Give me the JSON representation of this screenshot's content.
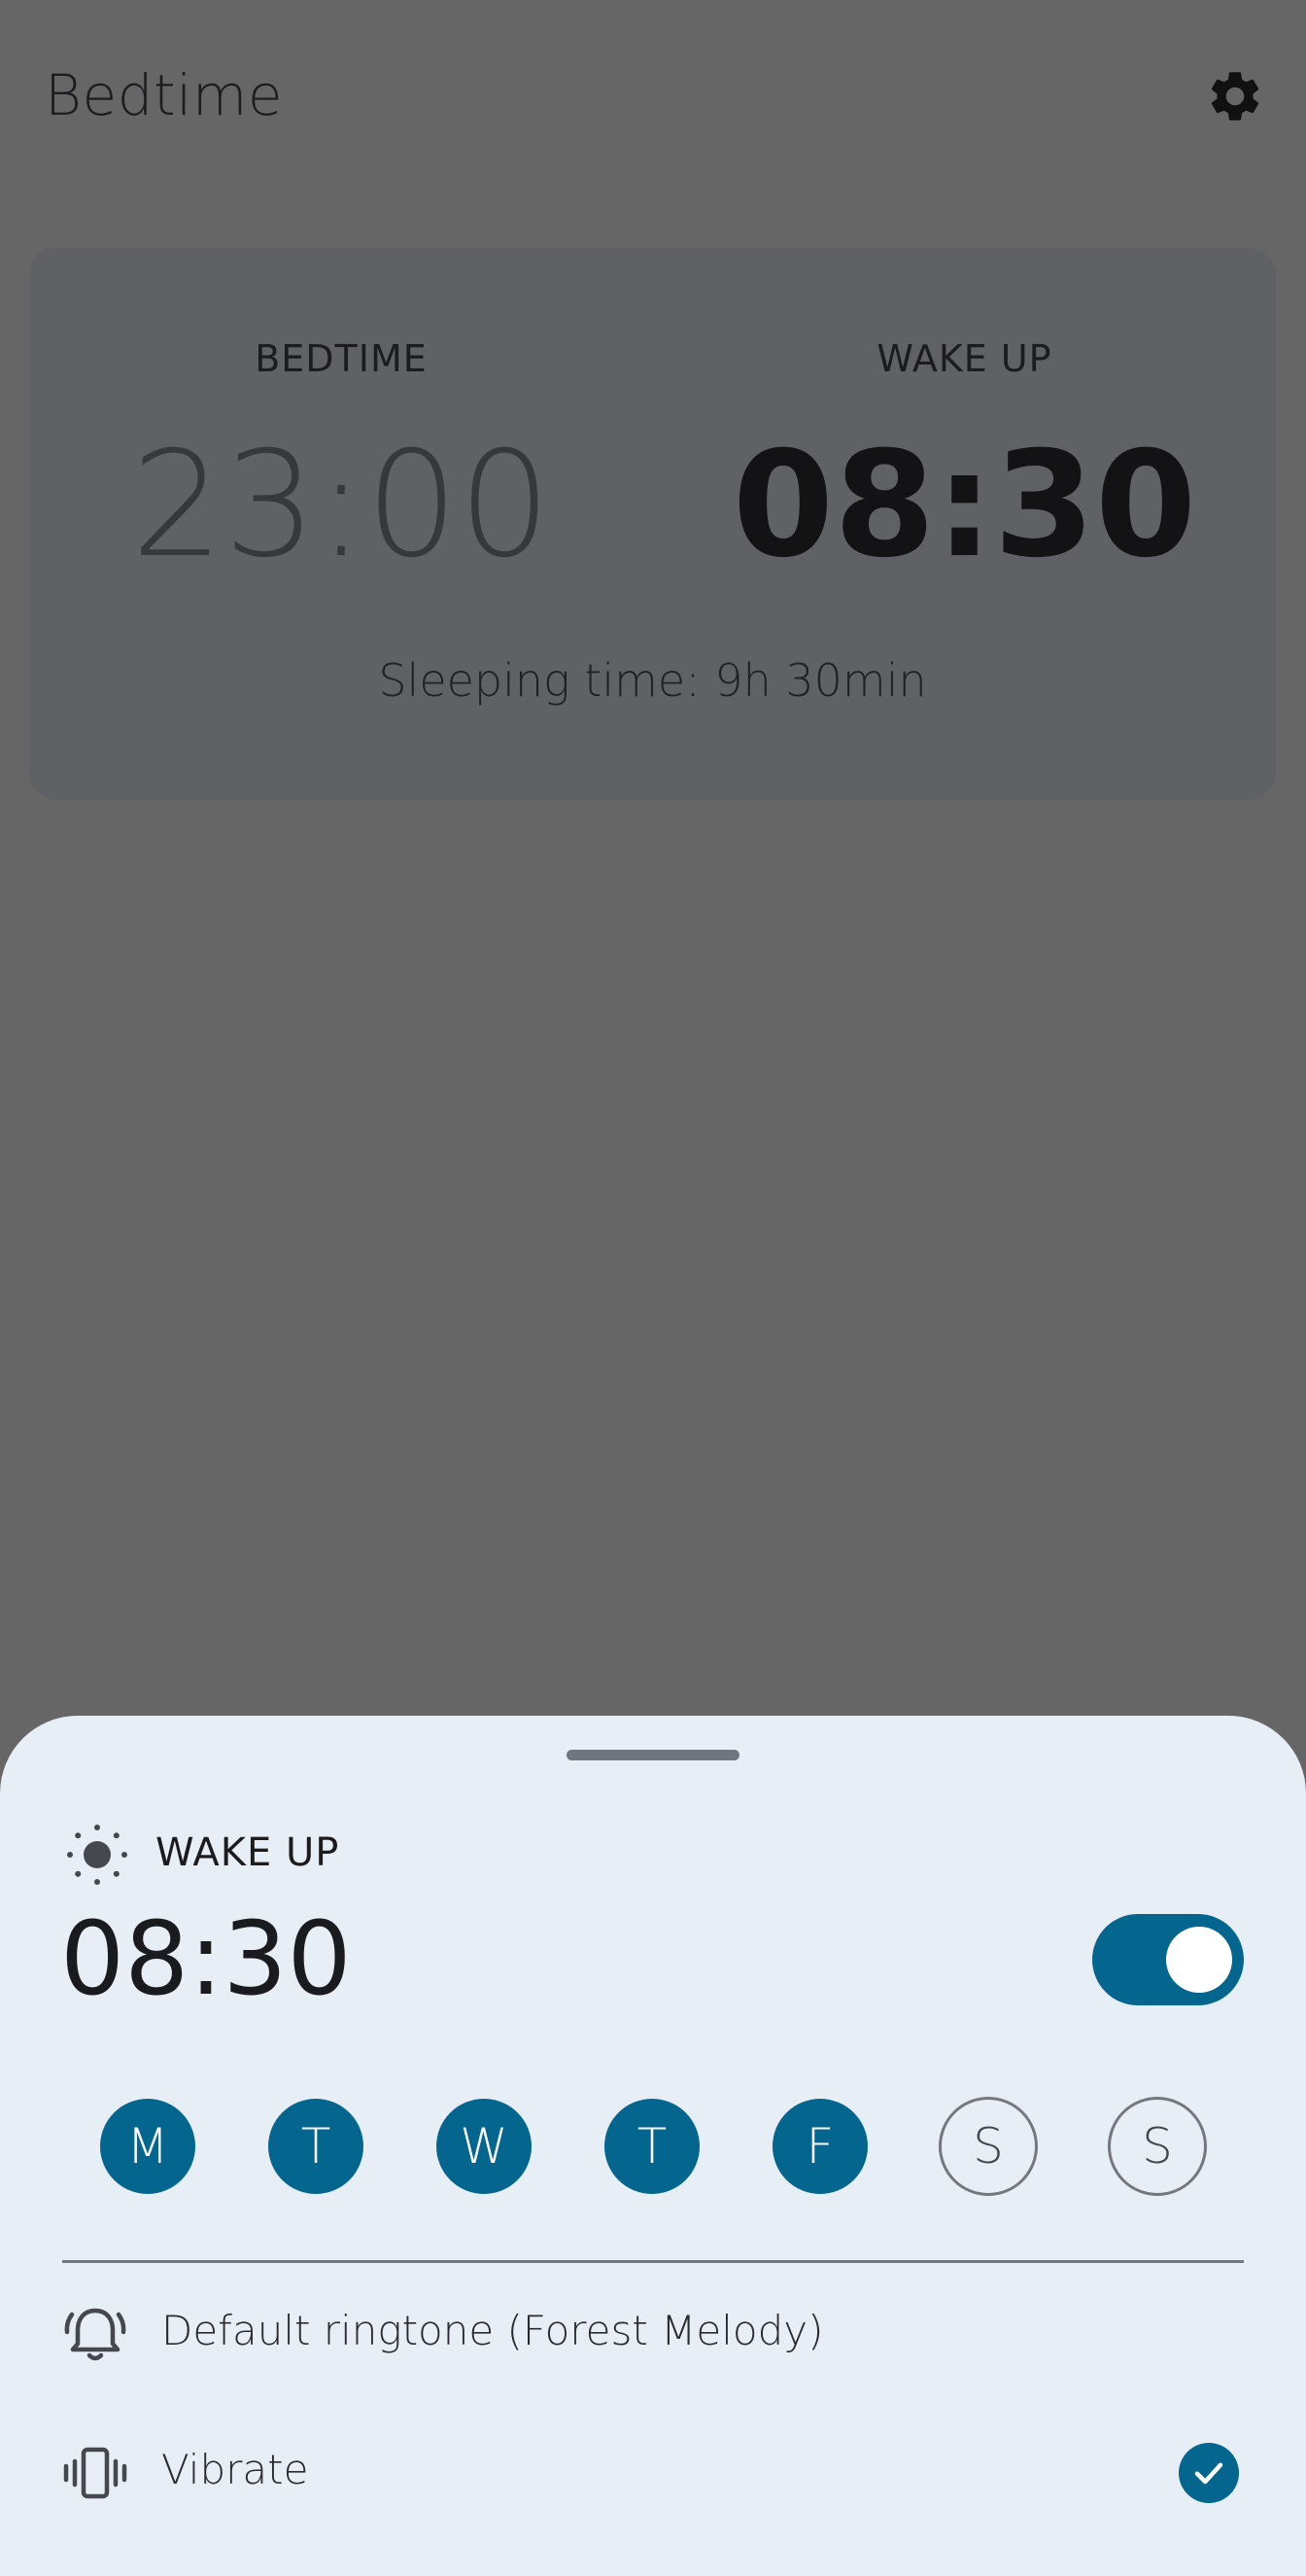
{
  "header": {
    "title": "Bedtime",
    "settings_icon": "gear-icon"
  },
  "summary": {
    "bedtime_label": "BEDTIME",
    "bedtime_time": "23:00",
    "wakeup_label": "WAKE UP",
    "wakeup_time": "08:30",
    "sleep_text": "Sleeping time: 9h 30min"
  },
  "sheet": {
    "icon": "sun-icon",
    "label": "WAKE UP",
    "time": "08:30",
    "enabled": true,
    "days": [
      {
        "letter": "M",
        "selected": true
      },
      {
        "letter": "T",
        "selected": true
      },
      {
        "letter": "W",
        "selected": true
      },
      {
        "letter": "T",
        "selected": true
      },
      {
        "letter": "F",
        "selected": true
      },
      {
        "letter": "S",
        "selected": false
      },
      {
        "letter": "S",
        "selected": false
      }
    ],
    "ringtone_label": "Default ringtone (Forest Melody)",
    "ringtone_icon": "alarm-bell-icon",
    "vibrate_label": "Vibrate",
    "vibrate_icon": "vibrate-icon",
    "vibrate_checked": true
  },
  "colors": {
    "accent": "#04668f",
    "scrim": "#666666",
    "sheet_bg": "#e8eef6"
  }
}
